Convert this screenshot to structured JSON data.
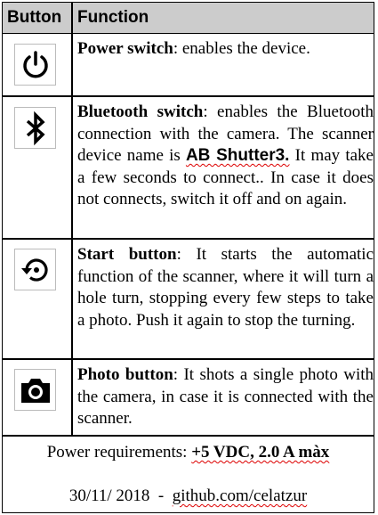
{
  "header": {
    "col1": "Button",
    "col2": "Function"
  },
  "rows": [
    {
      "icon": "power-icon",
      "title": "Power switch",
      "text": ": enables the device."
    },
    {
      "icon": "bluetooth-icon",
      "title": "Bluetooth switch",
      "text": ": enables the Bluetooth connection with the camera. The scanner device name is ",
      "device": "AB Shutter3.",
      "text2": " It may take a few seconds to connect.. In case it does not connects, switch it off and on again."
    },
    {
      "icon": "restart-icon",
      "title": "Start button",
      "text": ": It starts the automatic function of the scanner, where it  will turn a hole turn, stopping every few steps to take a photo. Push it again to stop the turning."
    },
    {
      "icon": "camera-icon",
      "title": "Photo button",
      "text": ": It shots a single photo with the camera, in case it is connected with the scanner."
    }
  ],
  "footer": {
    "power_label": "Power requirements: ",
    "power_value": "+5 VDC, 2.0 A màx",
    "date": "30/11/ 2018  -  ",
    "link": "github.com/celatzur"
  }
}
